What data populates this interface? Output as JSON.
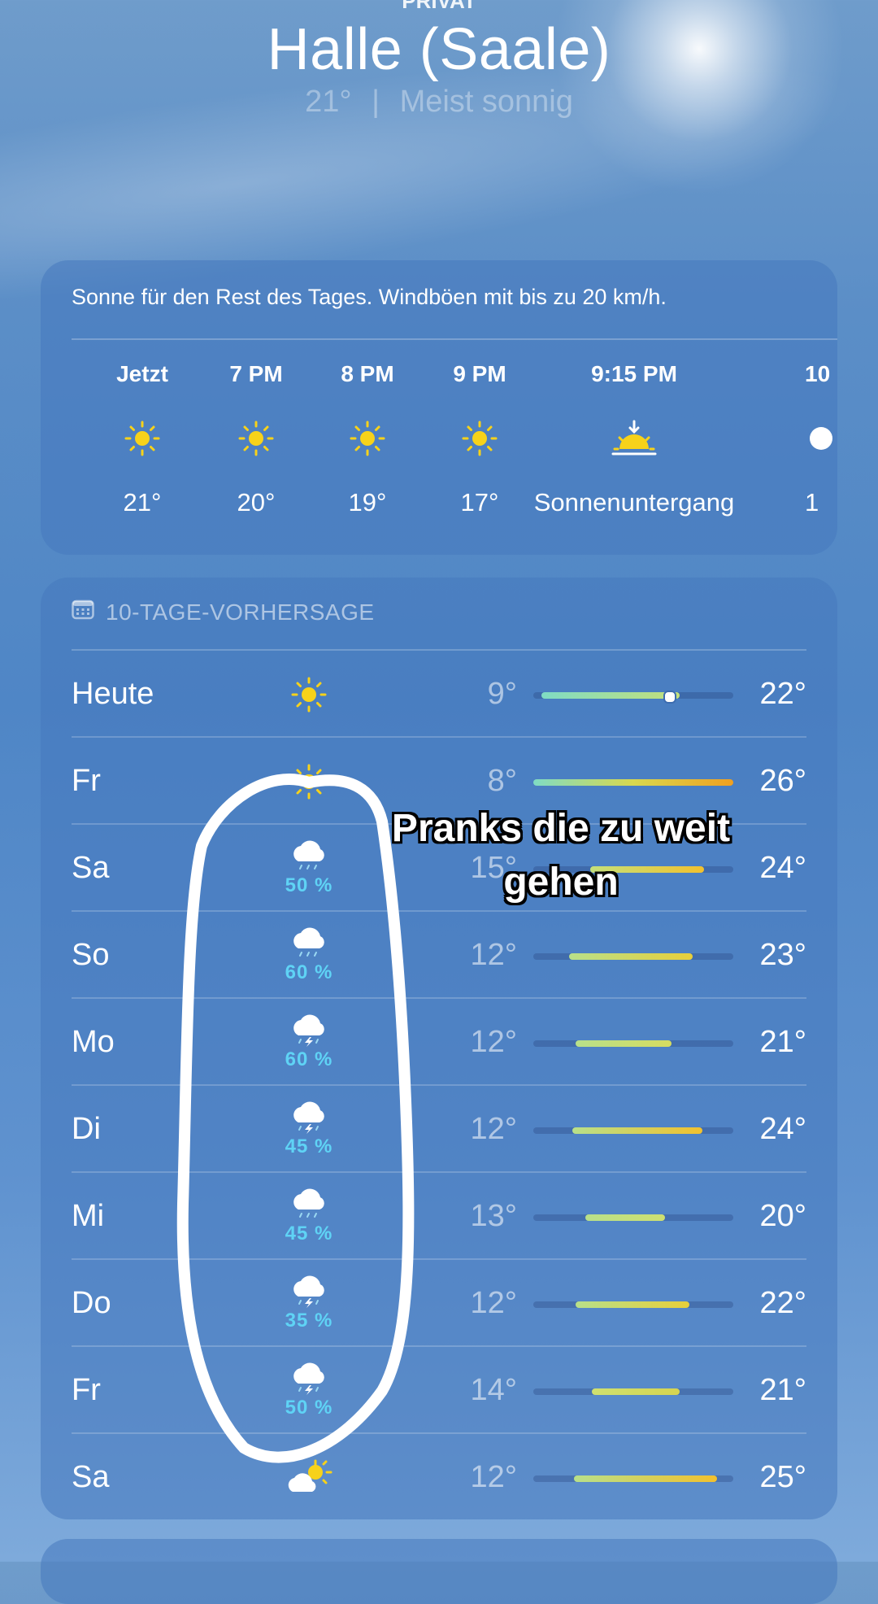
{
  "header": {
    "location_tag": "PRIVAT",
    "city": "Halle (Saale)",
    "current_temp": "21°",
    "separator": "|",
    "condition": "Meist sonnig"
  },
  "hourly": {
    "summary": "Sonne für den Rest des Tages. Windböen mit bis zu 20 km/h.",
    "items": [
      {
        "time": "Jetzt",
        "icon": "sun-icon",
        "temp": "21°"
      },
      {
        "time": "7 PM",
        "icon": "sun-icon",
        "temp": "20°"
      },
      {
        "time": "8 PM",
        "icon": "sun-icon",
        "temp": "19°"
      },
      {
        "time": "9 PM",
        "icon": "sun-icon",
        "temp": "17°"
      },
      {
        "time": "9:15 PM",
        "icon": "sunset-icon",
        "temp": "Sonnenuntergang"
      },
      {
        "time": "10",
        "icon": "moon-icon",
        "temp": "1"
      }
    ]
  },
  "daily": {
    "title": "10-TAGE-VORHERSAGE",
    "rows": [
      {
        "day": "Heute",
        "icon": "sun-icon",
        "precip": "",
        "low": "9°",
        "high": "22°"
      },
      {
        "day": "Fr",
        "icon": "sun-icon",
        "precip": "",
        "low": "8°",
        "high": "26°"
      },
      {
        "day": "Sa",
        "icon": "rain-cloud-icon",
        "precip": "50 %",
        "low": "15°",
        "high": "24°"
      },
      {
        "day": "So",
        "icon": "rain-cloud-icon",
        "precip": "60 %",
        "low": "12°",
        "high": "23°"
      },
      {
        "day": "Mo",
        "icon": "thunder-cloud-icon",
        "precip": "60 %",
        "low": "12°",
        "high": "21°"
      },
      {
        "day": "Di",
        "icon": "thunder-cloud-icon",
        "precip": "45 %",
        "low": "12°",
        "high": "24°"
      },
      {
        "day": "Mi",
        "icon": "rain-cloud-icon",
        "precip": "45 %",
        "low": "13°",
        "high": "20°"
      },
      {
        "day": "Do",
        "icon": "thunder-cloud-icon",
        "precip": "35 %",
        "low": "12°",
        "high": "22°"
      },
      {
        "day": "Fr",
        "icon": "thunder-cloud-icon",
        "precip": "50 %",
        "low": "14°",
        "high": "21°"
      },
      {
        "day": "Sa",
        "icon": "partly-sunny-icon",
        "precip": "",
        "low": "12°",
        "high": "25°"
      }
    ]
  },
  "overlay": {
    "caption_line1": "Pranks die zu weit",
    "caption_line2": "gehen"
  },
  "colors": {
    "sun": "#f7d21a",
    "precip": "#5fd3f5",
    "bar_cool": "#7fdcc4",
    "bar_warm": "#f2c12e",
    "bar_hot": "#f0a020"
  }
}
